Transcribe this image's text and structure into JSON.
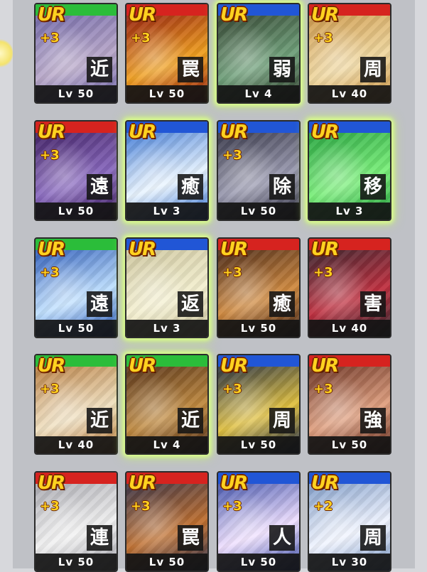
{
  "cards": [
    {
      "rarity": "UR",
      "plus": "+3",
      "type": "近",
      "level": "Lv 50",
      "band": "#2bbd3a",
      "art": [
        "#6a62a6",
        "#b8a7c9"
      ],
      "glow": false
    },
    {
      "rarity": "UR",
      "plus": "+3",
      "type": "罠",
      "level": "Lv 50",
      "band": "#d6231f",
      "art": [
        "#8a1010",
        "#f0a020"
      ],
      "glow": false
    },
    {
      "rarity": "UR",
      "plus": "",
      "type": "弱",
      "level": "Lv 4",
      "band": "#2156d6",
      "art": [
        "#2f3a2a",
        "#6fa07a"
      ],
      "glow": true
    },
    {
      "rarity": "UR",
      "plus": "+3",
      "type": "周",
      "level": "Lv 40",
      "band": "#d6231f",
      "art": [
        "#c89040",
        "#f0d8a0"
      ],
      "glow": false
    },
    {
      "rarity": "UR",
      "plus": "+3",
      "type": "遠",
      "level": "Lv 50",
      "band": "#d6231f",
      "art": [
        "#3a1a5a",
        "#8a6ac0"
      ],
      "glow": false
    },
    {
      "rarity": "UR",
      "plus": "",
      "type": "癒",
      "level": "Lv 3",
      "band": "#2156d6",
      "art": [
        "#2a6ad0",
        "#e8f4ff"
      ],
      "glow": true
    },
    {
      "rarity": "UR",
      "plus": "+3",
      "type": "除",
      "level": "Lv 50",
      "band": "#2156d6",
      "art": [
        "#2a2a3a",
        "#9a9ab0"
      ],
      "glow": false
    },
    {
      "rarity": "UR",
      "plus": "",
      "type": "移",
      "level": "Lv 3",
      "band": "#2156d6",
      "art": [
        "#1e9a3a",
        "#7aef7a"
      ],
      "glow": true
    },
    {
      "rarity": "UR",
      "plus": "+3",
      "type": "遠",
      "level": "Lv 50",
      "band": "#2bbd3a",
      "art": [
        "#1a4ab0",
        "#bfe0ff"
      ],
      "glow": false
    },
    {
      "rarity": "UR",
      "plus": "",
      "type": "返",
      "level": "Lv 3",
      "band": "#2156d6",
      "art": [
        "#c8c098",
        "#f4f0d0"
      ],
      "glow": true
    },
    {
      "rarity": "UR",
      "plus": "+3",
      "type": "癒",
      "level": "Lv 50",
      "band": "#d6231f",
      "art": [
        "#3a2018",
        "#d08a40"
      ],
      "glow": false
    },
    {
      "rarity": "UR",
      "plus": "+3",
      "type": "害",
      "level": "Lv 40",
      "band": "#d6231f",
      "art": [
        "#2a2a30",
        "#c03040"
      ],
      "glow": false
    },
    {
      "rarity": "UR",
      "plus": "+3",
      "type": "近",
      "level": "Lv 40",
      "band": "#2bbd3a",
      "art": [
        "#b07030",
        "#f0e0c0"
      ],
      "glow": false
    },
    {
      "rarity": "UR",
      "plus": "",
      "type": "近",
      "level": "Lv 4",
      "band": "#2bbd3a",
      "art": [
        "#4a2a18",
        "#c08a40"
      ],
      "glow": true
    },
    {
      "rarity": "UR",
      "plus": "+3",
      "type": "周",
      "level": "Lv 50",
      "band": "#2156d6",
      "art": [
        "#10204a",
        "#e0c040"
      ],
      "glow": false
    },
    {
      "rarity": "UR",
      "plus": "+3",
      "type": "強",
      "level": "Lv 50",
      "band": "#d6231f",
      "art": [
        "#5a2418",
        "#e0a080"
      ],
      "glow": false
    },
    {
      "rarity": "UR",
      "plus": "+3",
      "type": "連",
      "level": "Lv 50",
      "band": "#d6231f",
      "art": [
        "#a0a0a8",
        "#f0f0f0"
      ],
      "glow": false
    },
    {
      "rarity": "UR",
      "plus": "+3",
      "type": "罠",
      "level": "Lv 50",
      "band": "#d6231f",
      "art": [
        "#2a3050",
        "#c07030"
      ],
      "glow": false
    },
    {
      "rarity": "UR",
      "plus": "+3",
      "type": "人",
      "level": "Lv 50",
      "band": "#2156d6",
      "art": [
        "#2a40a0",
        "#f0e0ff"
      ],
      "glow": false
    },
    {
      "rarity": "UR",
      "plus": "+2",
      "type": "周",
      "level": "Lv 30",
      "band": "#2156d6",
      "art": [
        "#7090c0",
        "#f0f4ff"
      ],
      "glow": false
    }
  ]
}
